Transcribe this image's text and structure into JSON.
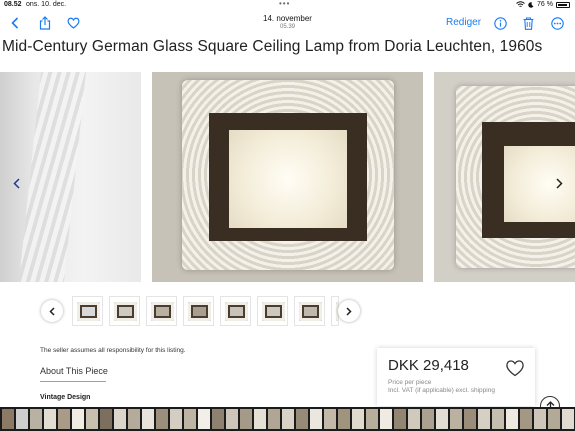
{
  "status_bar": {
    "time": "08.52",
    "date": "ons. 10. dec.",
    "dots": "•••",
    "battery": "76 %"
  },
  "nav": {
    "title": "14. november",
    "subtitle": "05.39",
    "edit_label": "Rediger",
    "icons": [
      "back-chevron",
      "share",
      "heart",
      "info",
      "trash",
      "more"
    ]
  },
  "listing": {
    "title": "Mid-Century German Glass Square Ceiling Lamp from Doria Leuchten, 1960s",
    "seller_note": "The seller assumes all responsibility for this listing.",
    "about_label": "About This Piece",
    "section_label": "Vintage Design",
    "price": "DKK 29,418",
    "price_label": "Price per piece",
    "vat_note": "Incl. VAT (if applicable) excl. shipping"
  },
  "thumbnails": [
    {
      "tone": "#d8d8d8"
    },
    {
      "tone": "#cfcac0"
    },
    {
      "tone": "#b8b0a0"
    },
    {
      "tone": "#a79f90"
    },
    {
      "tone": "#c8c3b8"
    },
    {
      "tone": "#cdc8be"
    },
    {
      "tone": "#bfb9ad"
    },
    {
      "tone": "#d2cdc3"
    }
  ],
  "filmstrip_colors": [
    "#8a7a66",
    "#cfcfcf",
    "#b9b1a2",
    "#e2ddd3",
    "#a99b88",
    "#f0ece4",
    "#c9bfae",
    "#7d6f5d",
    "#dcd6ca",
    "#b5ab9a",
    "#e8e4dc",
    "#9c8f7c",
    "#d4cec2",
    "#bdb4a4",
    "#f2efe9",
    "#8e8170",
    "#ccc5b8",
    "#a59a88",
    "#e5e0d6",
    "#b0a693",
    "#d9d3c7",
    "#978a76",
    "#ebe7df",
    "#c2b9a9",
    "#a0947f",
    "#dfd9ce",
    "#b8ae9c",
    "#efebe3",
    "#928571",
    "#d0c9bc",
    "#aca190",
    "#e3ded4",
    "#bbb1a0",
    "#9a8d79",
    "#d6d0c4",
    "#c5bdad",
    "#ede9e1",
    "#a49885",
    "#cdc6b9",
    "#b3a997",
    "#e0dacf",
    "#958874",
    "#d8d2c6",
    "#c0b7a7"
  ],
  "colors": {
    "accent": "#1a7cf5",
    "arrow": "#1a3c8f"
  }
}
